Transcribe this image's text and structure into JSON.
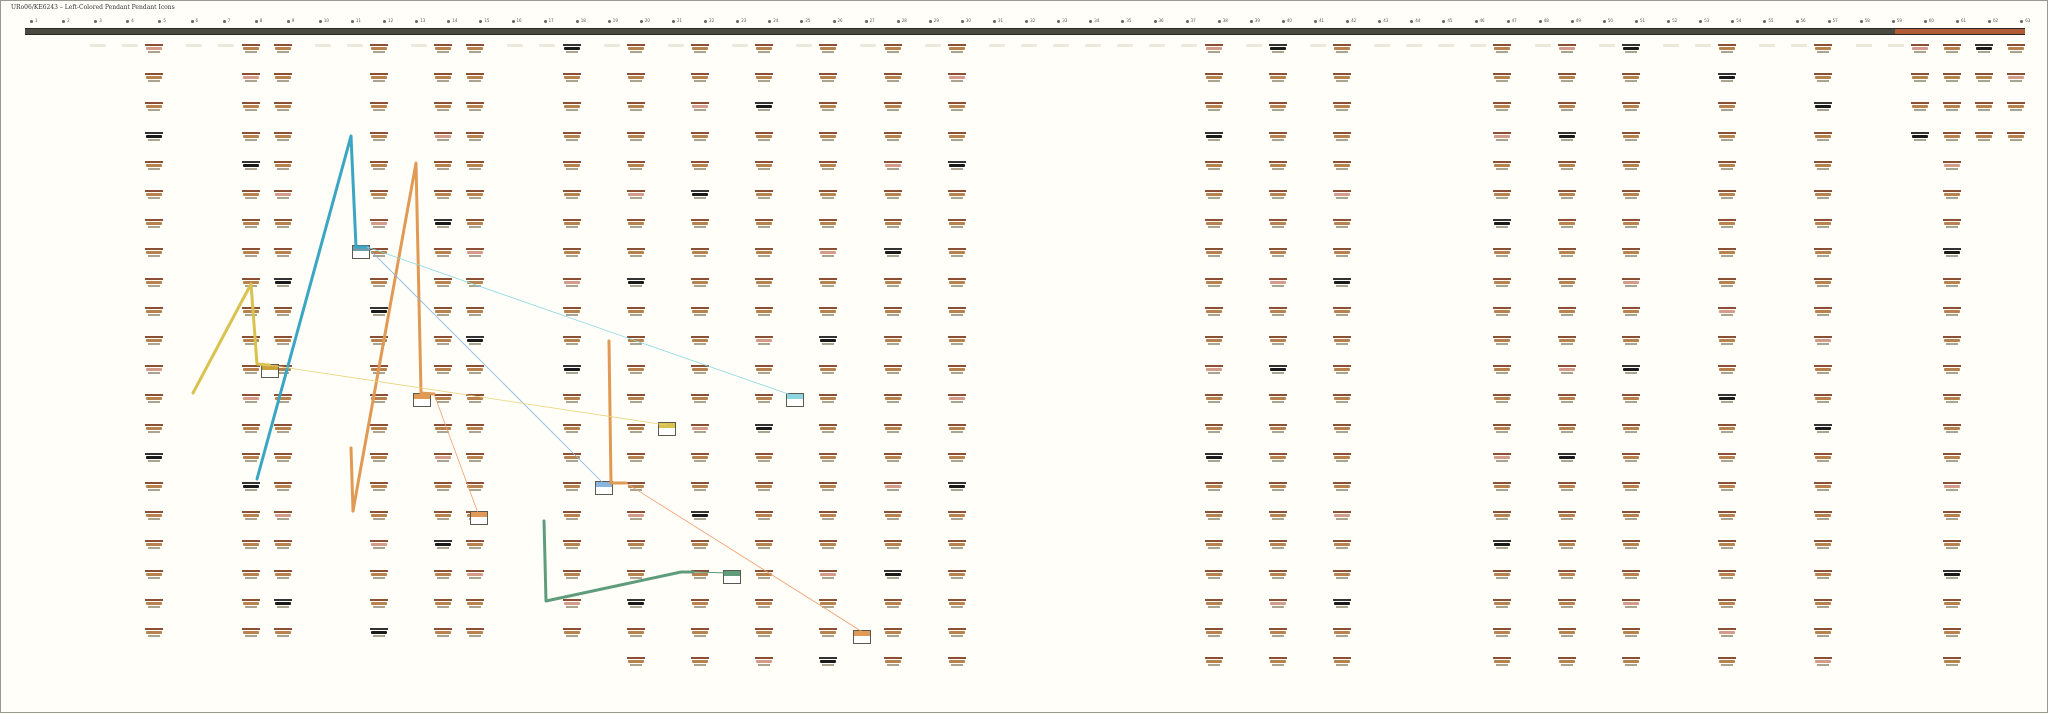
{
  "header": {
    "title": "URo06/KE6243 – Left-Colored Pendant Pendant Icons"
  },
  "columns": [
    "1",
    "2",
    "3",
    "4",
    "5",
    "6",
    "7",
    "8",
    "9",
    "10",
    "11",
    "12",
    "13",
    "14",
    "15",
    "16",
    "17",
    "18",
    "19",
    "20",
    "21",
    "22",
    "23",
    "24",
    "25",
    "26",
    "27",
    "28",
    "29",
    "30",
    "31",
    "32",
    "33",
    "34",
    "35",
    "36",
    "37",
    "38",
    "39",
    "40",
    "41",
    "42",
    "43",
    "44",
    "45",
    "46",
    "47",
    "48",
    "49",
    "50",
    "51",
    "52",
    "53",
    "54",
    "55",
    "56",
    "57",
    "58",
    "59",
    "60",
    "61",
    "62",
    "63"
  ],
  "colors": {
    "background": "#fffef8",
    "lane": "#4a4a42",
    "lane_accent": "#b05a38",
    "path_yellow": "#d9c250",
    "path_blue": "#3aa6c4",
    "path_orange": "#e09a55",
    "path_green": "#5f9c7c",
    "link_blue": "#8ab4e0",
    "link_cyan": "#8dd6e0",
    "link_yellow": "#e8d37a",
    "link_orange": "#f0a070"
  }
}
